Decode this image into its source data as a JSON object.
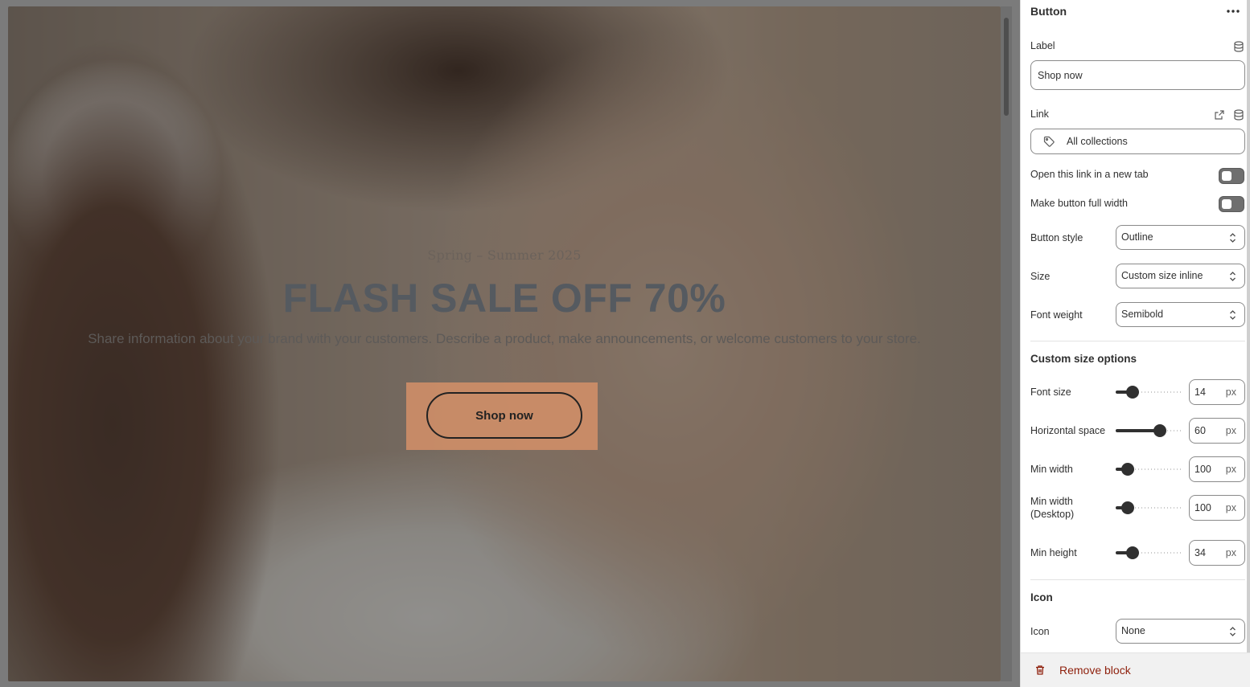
{
  "preview": {
    "eyebrow": "Spring – Summer 2025",
    "title": "FLASH SALE OFF 70%",
    "text": "Share information about your brand with your customers. Describe a product, make announcements, or welcome customers to your store.",
    "button_label": "Shop now"
  },
  "panel": {
    "title": "Button",
    "label_field": {
      "label": "Label",
      "value": "Shop now"
    },
    "link_field": {
      "label": "Link",
      "value": "All collections"
    },
    "toggles": [
      {
        "label": "Open this link in a new tab",
        "on": false
      },
      {
        "label": "Make button full width",
        "on": false
      }
    ],
    "selects": [
      {
        "label": "Button style",
        "value": "Outline"
      },
      {
        "label": "Size",
        "value": "Custom size inline"
      },
      {
        "label": "Font weight",
        "value": "Semibold"
      }
    ],
    "custom_size": {
      "title": "Custom size options",
      "font_size": {
        "label": "Font size",
        "value": "14",
        "unit": "px",
        "level": 0.2
      },
      "horizontal_space": {
        "label": "Horizontal space",
        "value": "60",
        "unit": "px",
        "level": 0.7
      },
      "min_width": {
        "label": "Min width",
        "value": "100",
        "unit": "px",
        "level": 0.1
      },
      "min_width_desktop": {
        "label_line1": "Min width",
        "label_line2": "(Desktop)",
        "value": "100",
        "unit": "px",
        "level": 0.1
      },
      "min_height": {
        "label": "Min height",
        "value": "34",
        "unit": "px",
        "level": 0.2
      }
    },
    "icon_section": {
      "title": "Icon",
      "icon_label": "Icon",
      "icon_value": "None"
    },
    "footer": {
      "remove_label": "Remove block"
    }
  },
  "colors": {
    "panel_bg": "#ffffff",
    "remove_red": "#8e1f0b",
    "button_highlight": "#d59169",
    "text_dark": "#303030"
  },
  "icons": [
    "more-icon",
    "database-icon",
    "external-link-icon",
    "tag-icon",
    "chevron-updown-icon",
    "trash-icon"
  ]
}
